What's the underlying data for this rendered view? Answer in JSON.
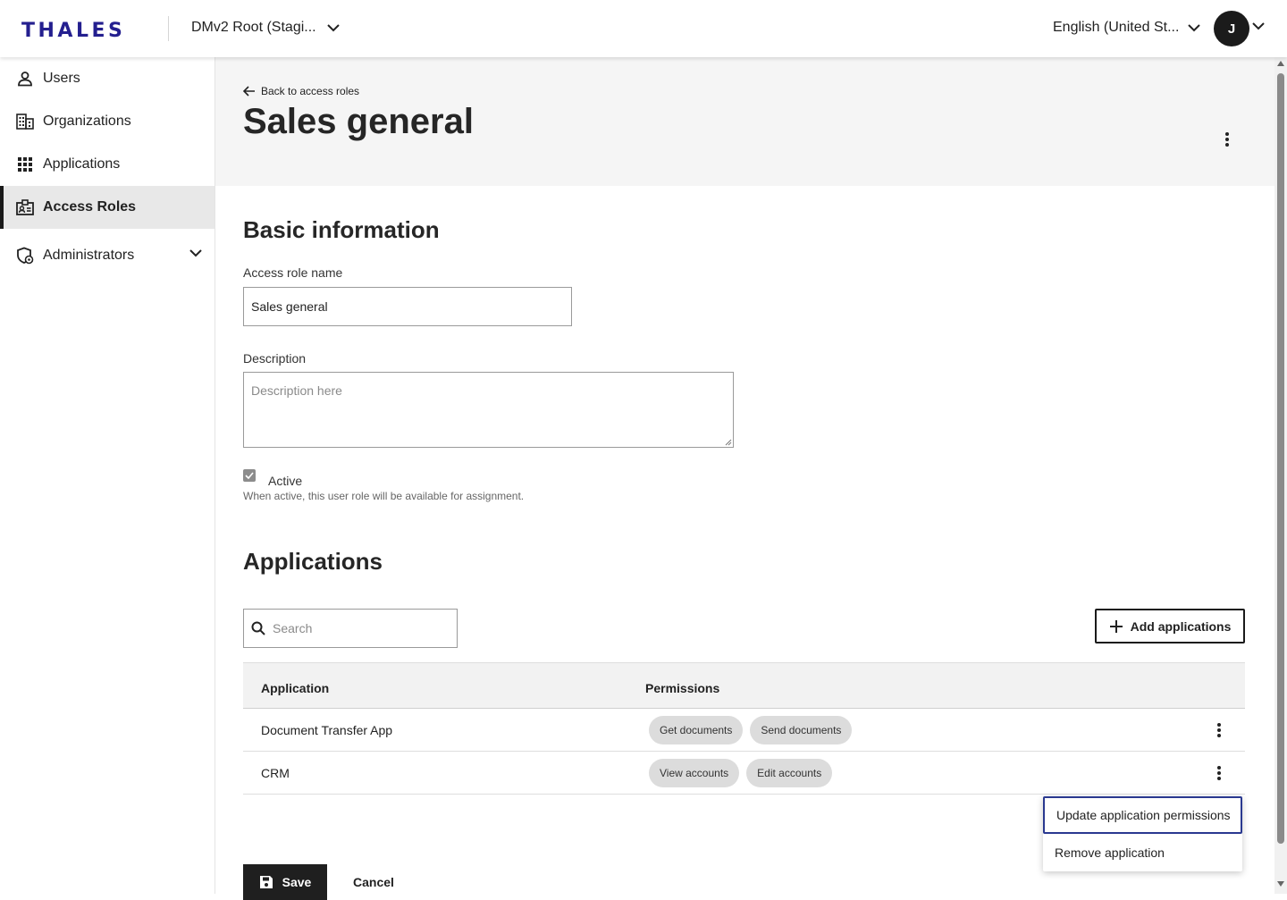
{
  "header": {
    "logo": "THALES",
    "org_selector": "DMv2 Root (Stagi...",
    "language_selector": "English (United St...",
    "avatar_initial": "J"
  },
  "sidebar": {
    "items": [
      {
        "label": "Users",
        "icon": "person-icon"
      },
      {
        "label": "Organizations",
        "icon": "building-icon"
      },
      {
        "label": "Applications",
        "icon": "grid-icon"
      },
      {
        "label": "Access Roles",
        "icon": "badge-icon",
        "active": true
      },
      {
        "label": "Administrators",
        "icon": "shield-gear-icon",
        "expandable": true
      }
    ]
  },
  "page": {
    "back_link": "Back to access roles",
    "title": "Sales general"
  },
  "basic_info": {
    "heading": "Basic information",
    "name_label": "Access role name",
    "name_value": "Sales general",
    "description_label": "Description",
    "description_placeholder": "Description here",
    "active_label": "Active",
    "active_checked": true,
    "active_helper": "When active, this user role will be available for assignment."
  },
  "applications": {
    "heading": "Applications",
    "search_placeholder": "Search",
    "add_button": "Add applications",
    "columns": [
      "Application",
      "Permissions"
    ],
    "rows": [
      {
        "name": "Document Transfer App",
        "permissions": [
          "Get documents",
          "Send documents"
        ]
      },
      {
        "name": "CRM",
        "permissions": [
          "View accounts",
          "Edit accounts"
        ]
      }
    ],
    "row_menu": [
      "Update application permissions",
      "Remove application"
    ]
  },
  "footer": {
    "save_label": "Save",
    "cancel_label": "Cancel"
  },
  "colors": {
    "brand": "#241f8f",
    "primary_button": "#1f1f1f",
    "focus_ring": "#2a3990",
    "chip_bg": "#dcdcdc"
  }
}
